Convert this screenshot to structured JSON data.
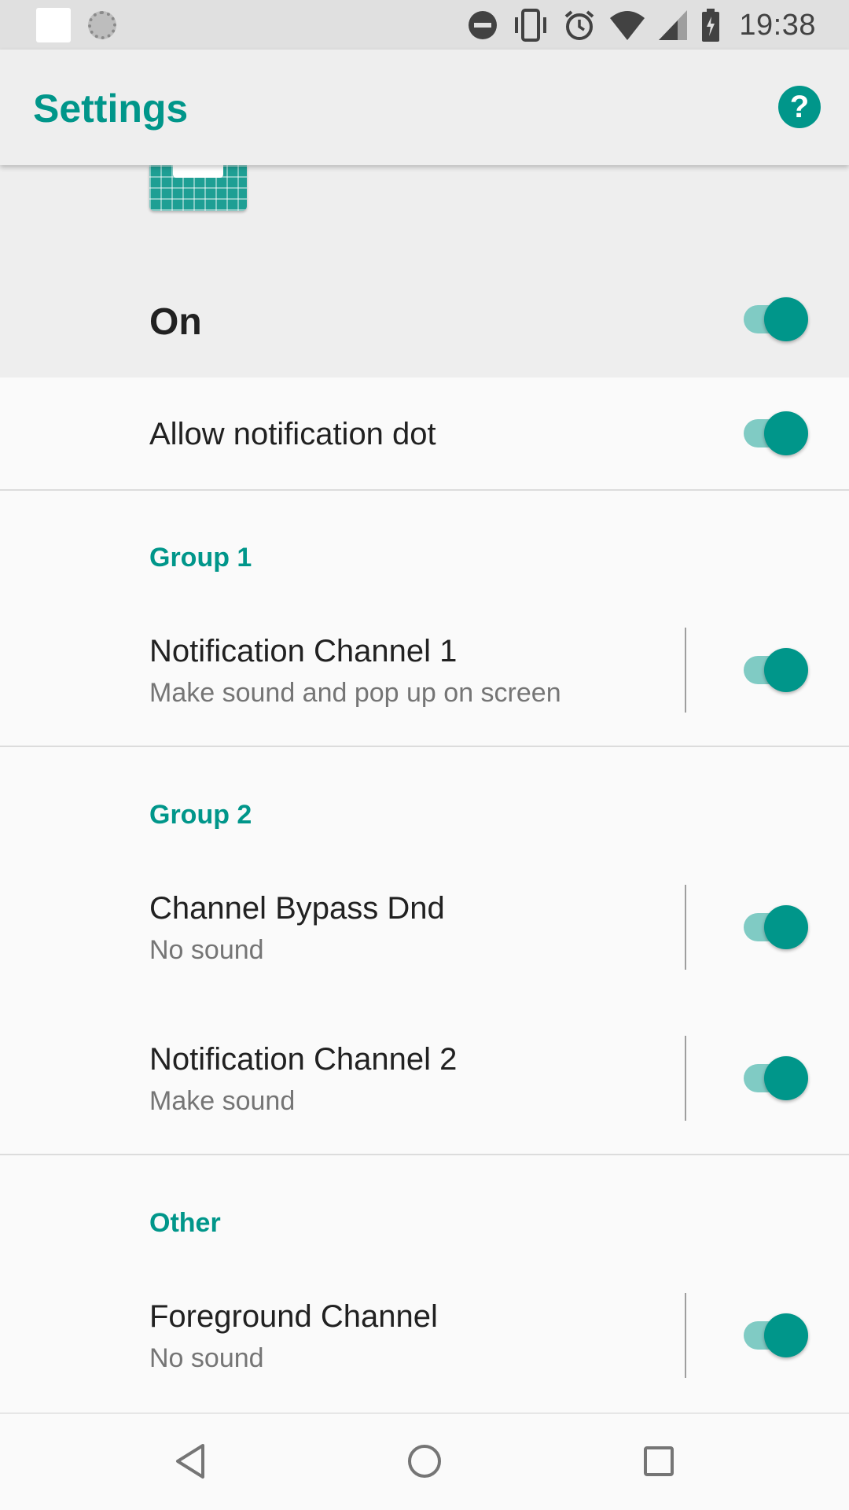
{
  "status_bar": {
    "time": "19:38",
    "icons": [
      "notification-square-icon",
      "sync-dots-icon",
      "dnd-icon",
      "vibrate-icon",
      "alarm-icon",
      "wifi-icon",
      "cell-signal-icon",
      "battery-icon"
    ]
  },
  "app_bar": {
    "title": "Settings",
    "help_label": "?"
  },
  "header": {
    "master_toggle_label": "On",
    "master_toggle_on": true
  },
  "settings": {
    "notification_dot": {
      "label": "Allow notification dot",
      "on": true
    }
  },
  "groups": [
    {
      "title": "Group 1",
      "channels": [
        {
          "name": "Notification Channel 1",
          "behavior": "Make sound and pop up on screen",
          "on": true
        }
      ]
    },
    {
      "title": "Group 2",
      "channels": [
        {
          "name": "Channel Bypass Dnd",
          "behavior": "No sound",
          "on": true
        },
        {
          "name": "Notification Channel 2",
          "behavior": "Make sound",
          "on": true
        }
      ]
    },
    {
      "title": "Other",
      "channels": [
        {
          "name": "Foreground Channel",
          "behavior": "No sound",
          "on": true
        }
      ]
    }
  ],
  "nav_bar": {
    "buttons": [
      "back-icon",
      "home-icon",
      "recents-icon"
    ]
  },
  "colors": {
    "accent": "#00968a",
    "track": "#80cbc4",
    "header_bg": "#eeeeee",
    "page_bg": "#fafafa"
  }
}
